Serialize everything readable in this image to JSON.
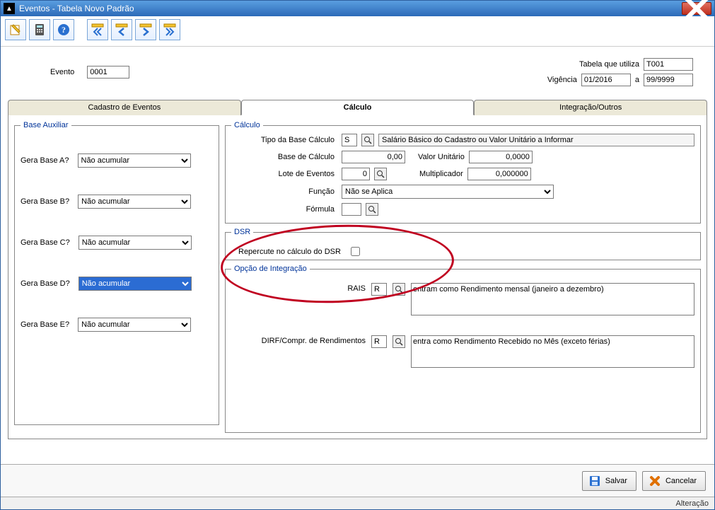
{
  "window": {
    "title": "Eventos - Tabela Novo Padrão"
  },
  "header": {
    "evento": {
      "label": "Evento",
      "value": "0001"
    },
    "tabela": {
      "label": "Tabela que utiliza",
      "value": "T001"
    },
    "vigencia": {
      "label": "Vigência",
      "from": "01/2016",
      "sep": "a",
      "to": "99/9999"
    }
  },
  "tabs": {
    "cadastro": "Cadastro de Eventos",
    "calculo": "Cálculo",
    "integracao": "Integração/Outros",
    "active": "calculo"
  },
  "baseaux": {
    "legend": "Base Auxiliar",
    "option": "Não acumular",
    "items": [
      {
        "label": "Gera Base A?",
        "selected": false
      },
      {
        "label": "Gera Base B?",
        "selected": false
      },
      {
        "label": "Gera Base C?",
        "selected": false
      },
      {
        "label": "Gera Base D?",
        "selected": true
      },
      {
        "label": "Gera Base E?",
        "selected": false
      }
    ]
  },
  "calculo": {
    "legend": "Cálculo",
    "tipo_base": {
      "label": "Tipo da Base Cálculo",
      "code": "S",
      "desc": "Salário Básico do Cadastro ou Valor Unitário a Informar"
    },
    "base_calc": {
      "label": "Base de Cálculo",
      "value": "0,00"
    },
    "valor_unit": {
      "label": "Valor Unitário",
      "value": "0,0000"
    },
    "lote": {
      "label": "Lote de Eventos",
      "value": "0"
    },
    "mult": {
      "label": "Multiplicador",
      "value": "0,000000"
    },
    "funcao": {
      "label": "Função",
      "value": "Não se Aplica"
    },
    "formula": {
      "label": "Fórmula",
      "value": ""
    }
  },
  "dsr": {
    "legend": "DSR",
    "label": "Repercute no cálculo do DSR",
    "checked": false
  },
  "integracao": {
    "legend": "Opção de Integração",
    "rais": {
      "label": "RAIS",
      "code": "R",
      "desc": "entram como Rendimento mensal (janeiro a dezembro)"
    },
    "dirf": {
      "label": "DIRF/Compr. de Rendimentos",
      "code": "R",
      "desc": "entra como Rendimento Recebido no Mês (exceto férias)"
    }
  },
  "footer": {
    "salvar": "Salvar",
    "cancelar": "Cancelar"
  },
  "status": {
    "mode": "Alteração"
  }
}
